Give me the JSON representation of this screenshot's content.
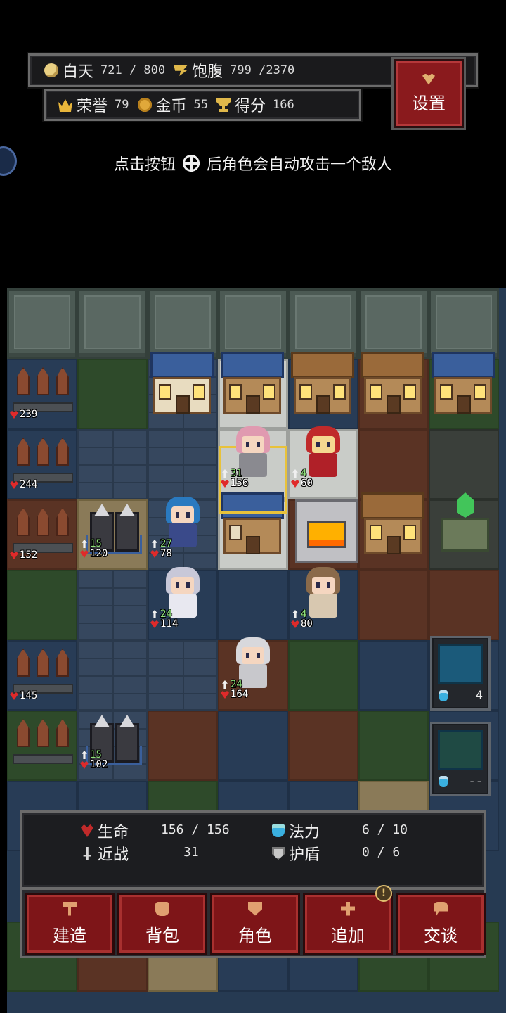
{
  "hud": {
    "day_label": "白天",
    "day_value": "721 / 800",
    "hunger_label": "饱腹",
    "hunger_value": "799 /2370",
    "honor_label": "荣誉",
    "honor_value": "79",
    "gold_label": "金币",
    "gold_value": "55",
    "score_label": "得分",
    "score_value": "166",
    "settings_label": "设置"
  },
  "hint": {
    "before": "点击按钮",
    "after": "后角色会自动攻击一个敌人",
    "badge": "22"
  },
  "units": {
    "wall_1_hp": "239",
    "wall_2_hp": "244",
    "wall_3_hp": "152",
    "wall_4_hp": "145",
    "knights_1_atk": "15",
    "knights_1_hp": "120",
    "knights_2_atk": "15",
    "knights_2_hp": "102",
    "archer_atk": "27",
    "archer_hp": "78",
    "paladin_atk": "31",
    "paladin_hp": "156",
    "redhood_atk": "4",
    "redhood_hp": "60",
    "priest_atk": "24",
    "priest_hp": "114",
    "girl_atk": "4",
    "girl_hp": "80",
    "viking_atk": "24",
    "viking_hp": "164"
  },
  "skills": {
    "lightning_cost": "4",
    "shield_cost": "--"
  },
  "panel": {
    "life_label": "生命",
    "life_value": "156 / 156",
    "mana_label": "法力",
    "mana_value": "6  /  10",
    "melee_label": "近战",
    "melee_value": "31",
    "shield_label": "护盾",
    "shield_value": "0  /  6"
  },
  "actions": {
    "build": "建造",
    "backpack": "背包",
    "character": "角色",
    "add": "追加",
    "talk": "交谈",
    "add_alert": "!"
  },
  "colors": {
    "button_red": "#7e1518",
    "heal_green": "#8ee07a",
    "hp_red": "#e02a2a",
    "gold": "#e7b53b"
  }
}
